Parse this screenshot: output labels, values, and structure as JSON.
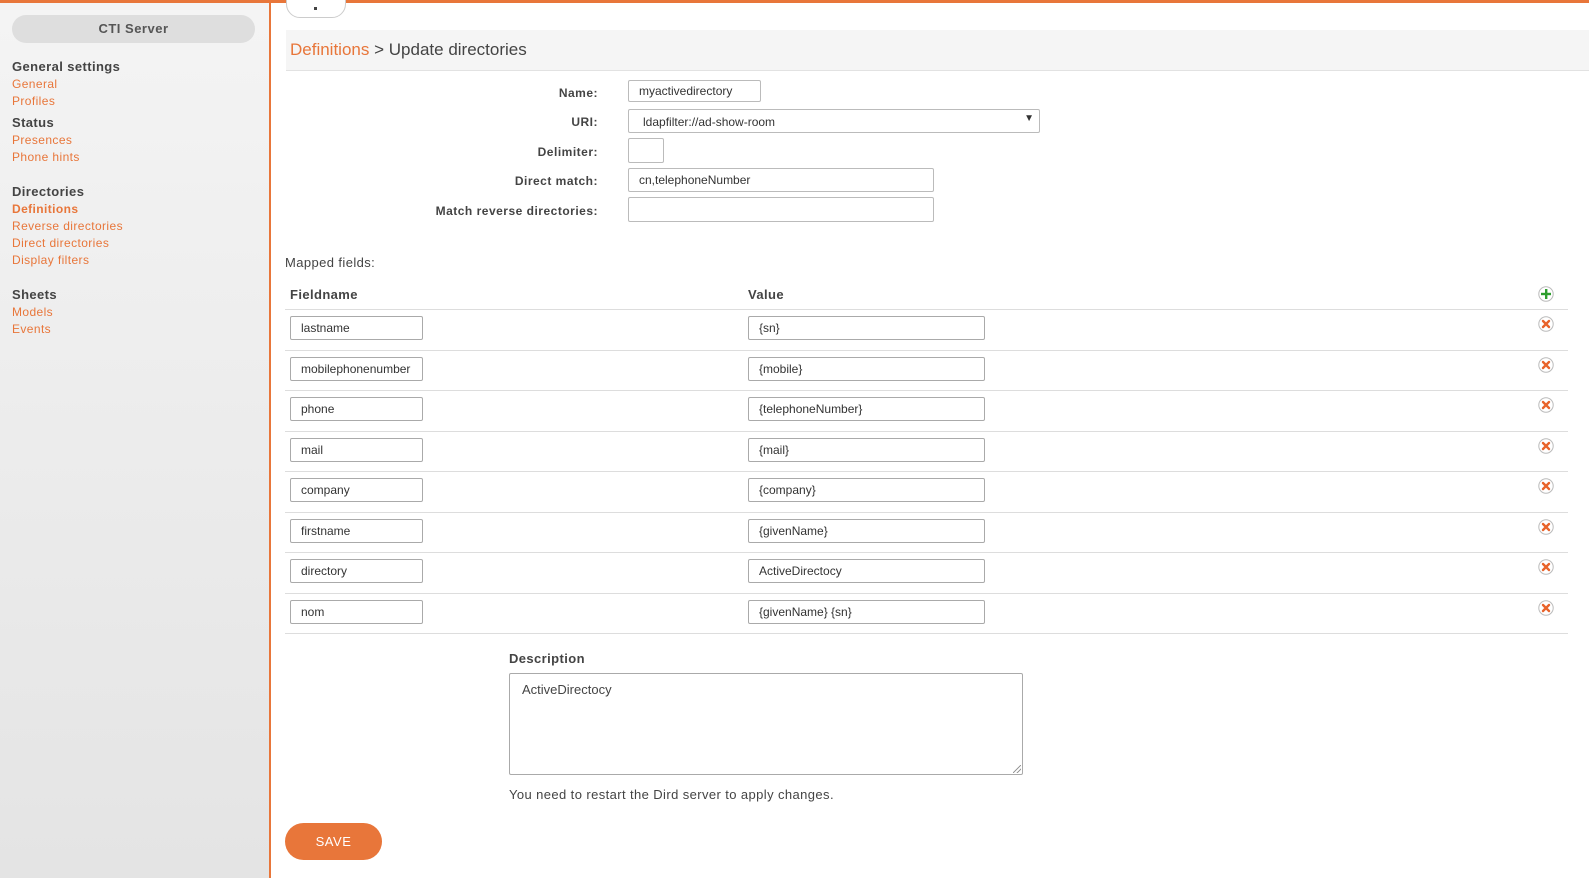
{
  "sidebar": {
    "title": "CTI Server",
    "sections": [
      {
        "heading": "General settings",
        "items": [
          "General",
          "Profiles"
        ]
      },
      {
        "heading": "Status",
        "items": [
          "Presences",
          "Phone hints"
        ]
      },
      {
        "heading": "Directories",
        "items": [
          "Definitions",
          "Reverse directories",
          "Direct directories",
          "Display filters"
        ],
        "active": "Definitions"
      },
      {
        "heading": "Sheets",
        "items": [
          "Models",
          "Events"
        ]
      }
    ]
  },
  "breadcrumb": {
    "link": "Definitions",
    "separator": ">",
    "current": "Update directories"
  },
  "form": {
    "name_label": "Name:",
    "name_value": "myactivedirectory",
    "uri_label": "URI:",
    "uri_value": "ldapfilter://ad-show-room",
    "delimiter_label": "Delimiter:",
    "delimiter_value": "",
    "direct_match_label": "Direct match:",
    "direct_match_value": "cn,telephoneNumber",
    "match_reverse_label": "Match reverse directories:",
    "match_reverse_value": ""
  },
  "mapped": {
    "label": "Mapped fields:",
    "col_fieldname": "Fieldname",
    "col_value": "Value",
    "rows": [
      {
        "fieldname": "lastname",
        "value": "{sn}"
      },
      {
        "fieldname": "mobilephonenumber",
        "value": "{mobile}"
      },
      {
        "fieldname": "phone",
        "value": "{telephoneNumber}"
      },
      {
        "fieldname": "mail",
        "value": "{mail}"
      },
      {
        "fieldname": "company",
        "value": "{company}"
      },
      {
        "fieldname": "firstname",
        "value": "{givenName}"
      },
      {
        "fieldname": "directory",
        "value": "ActiveDirectocy"
      },
      {
        "fieldname": "nom",
        "value": "{givenName} {sn}"
      }
    ]
  },
  "description": {
    "label": "Description",
    "value": "ActiveDirectocy"
  },
  "notice": "You need to restart the Dird server to apply changes.",
  "save_label": "SAVE",
  "colors": {
    "accent": "#e8763a",
    "add_icon": "#2e9e2e",
    "remove_icon": "#e8632a"
  }
}
